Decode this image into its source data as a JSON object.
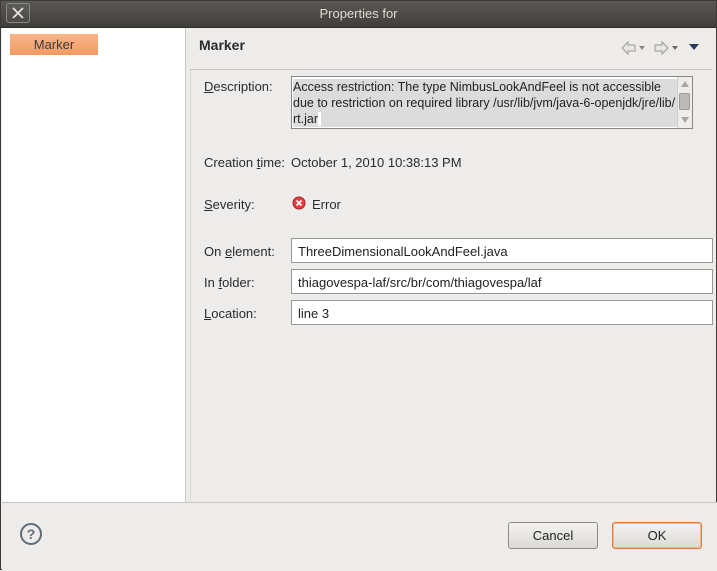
{
  "window": {
    "title": "Properties for"
  },
  "sidebar": {
    "items": [
      {
        "label": "Marker"
      }
    ]
  },
  "page": {
    "title": "Marker"
  },
  "fields": {
    "description": {
      "label_prefix": "",
      "label_mnemonic": "D",
      "label_rest": "escription:",
      "value": "Access restriction: The type NimbusLookAndFeel is not accessible due to restriction on required library /usr/lib/jvm/java-6-openjdk/jre/lib/",
      "value_tail": "rt.jar"
    },
    "creation_time": {
      "label_prefix": "Creation ",
      "label_mnemonic": "t",
      "label_rest": "ime:",
      "value": "October 1, 2010 10:38:13 PM"
    },
    "severity": {
      "label_prefix": "",
      "label_mnemonic": "S",
      "label_rest": "everity:",
      "value": "Error",
      "icon": "error-icon"
    },
    "on_element": {
      "label_prefix": "On ",
      "label_mnemonic": "e",
      "label_rest": "lement:",
      "value": "ThreeDimensionalLookAndFeel.java"
    },
    "in_folder": {
      "label_prefix": "In ",
      "label_mnemonic": "f",
      "label_rest": "older:",
      "value": "thiagovespa-laf/src/br/com/thiagovespa/laf"
    },
    "location": {
      "label_prefix": "",
      "label_mnemonic": "L",
      "label_rest": "ocation:",
      "value": "line 3"
    }
  },
  "buttons": {
    "cancel": "Cancel",
    "ok": "OK",
    "help": "?"
  },
  "colors": {
    "accent": "#f39a62",
    "error": "#e04040",
    "titlebar": "#4a4945"
  }
}
